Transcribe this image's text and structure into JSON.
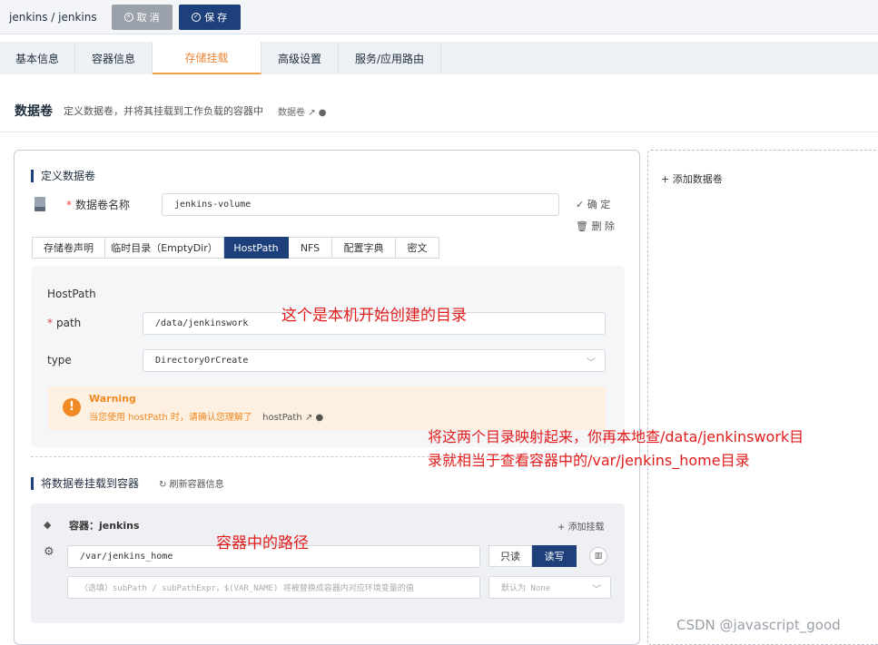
{
  "topbar": {
    "breadcrumb": "jenkins / jenkins",
    "cancel_label": "取 消",
    "save_label": "保 存"
  },
  "tabs": [
    {
      "label": "基本信息"
    },
    {
      "label": "容器信息"
    },
    {
      "label": "存储挂载"
    },
    {
      "label": "高级设置"
    },
    {
      "label": "服务/应用路由"
    }
  ],
  "section": {
    "title": "数据卷",
    "description": "定义数据卷，并将其挂载到工作负载的容器中",
    "doc_link": "数据卷"
  },
  "volume_def": {
    "title": "定义数据卷",
    "name_label": "数据卷名称",
    "name_value": "jenkins-volume",
    "confirm_label": "确 定",
    "delete_label": "删 除",
    "type_tabs": [
      "存储卷声明",
      "临时目录（EmptyDir）",
      "HostPath",
      "NFS",
      "配置字典",
      "密文"
    ],
    "active_type": "HostPath",
    "hostpath": {
      "title": "HostPath",
      "path_label": "path",
      "path_value": "/data/jenkinswork",
      "type_label": "type",
      "type_value": "DirectoryOrCreate"
    },
    "warning": {
      "title": "Warning",
      "text": "当您使用 hostPath 时，请确认您理解了",
      "link": "hostPath"
    }
  },
  "mount": {
    "title": "将数据卷挂载到容器",
    "refresh_label": "刷新容器信息",
    "container_label": "容器：",
    "container_name": "jenkins",
    "add_mount_label": "添加挂载",
    "mount_path": "/var/jenkins_home",
    "readonly_label": "只读",
    "readwrite_label": "读写",
    "subpath_placeholder": "（选填）subPath / subPathExpr，$(VAR_NAME) 将被替换成容器内对应环境变量的值",
    "propagation_placeholder": "默认为 None"
  },
  "right_panel": {
    "add_volume_label": "添加数据卷"
  },
  "annotations": {
    "a1": "这个是本机开始创建的目录",
    "a2_line1": "将这两个目录映射起来，你再本地查/data/jenkinswork目",
    "a2_line2": "录就相当于查看容器中的/var/jenkins_home目录",
    "a3": "容器中的路径"
  },
  "watermark": "CSDN @javascript_good",
  "colors": {
    "primary": "#1d3f7a",
    "active_tab": "#e8873a",
    "warning": "#f08a24",
    "annotation": "#e21b1b"
  }
}
